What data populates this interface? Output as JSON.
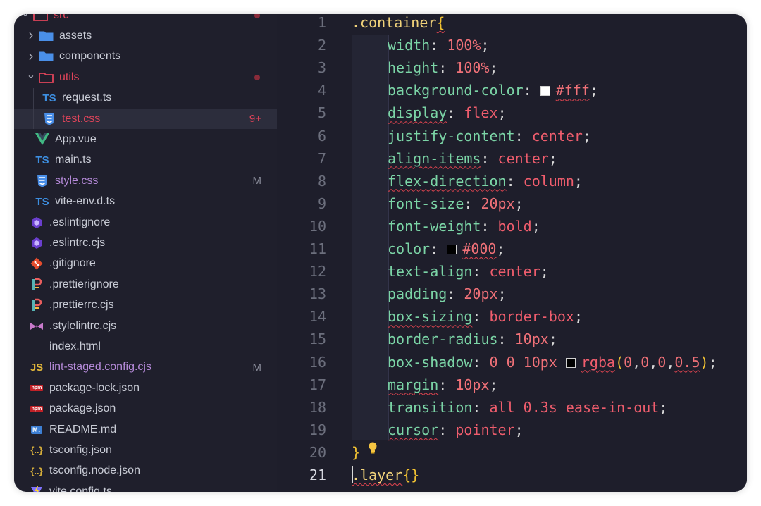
{
  "explorer": {
    "items": [
      {
        "label": "src",
        "kind": "folder-open",
        "color": "#e0445a",
        "indent": 0,
        "chevron": "down",
        "dot": true
      },
      {
        "label": "assets",
        "kind": "folder",
        "indent": 1,
        "chevron": "right"
      },
      {
        "label": "components",
        "kind": "folder",
        "indent": 1,
        "chevron": "right"
      },
      {
        "label": "utils",
        "kind": "folder-open",
        "color": "#e0445a",
        "indent": 1,
        "chevron": "down",
        "dot": true
      },
      {
        "label": "request.ts",
        "kind": "ts",
        "indent": 2
      },
      {
        "label": "test.css",
        "kind": "css",
        "color": "#e0445a",
        "indent": 2,
        "selected": true,
        "badge": "9+",
        "badge_color": "#e0445a"
      },
      {
        "label": "App.vue",
        "kind": "vue",
        "indent": 1
      },
      {
        "label": "main.ts",
        "kind": "ts",
        "indent": 1
      },
      {
        "label": "style.css",
        "kind": "css",
        "color": "#b58ad9",
        "indent": 1,
        "badge": "M"
      },
      {
        "label": "vite-env.d.ts",
        "kind": "ts",
        "indent": 1
      },
      {
        "label": ".eslintignore",
        "kind": "eslint",
        "indent": 0
      },
      {
        "label": ".eslintrc.cjs",
        "kind": "eslint",
        "indent": 0
      },
      {
        "label": ".gitignore",
        "kind": "git",
        "indent": 0
      },
      {
        "label": ".prettierignore",
        "kind": "prettier",
        "indent": 0
      },
      {
        "label": ".prettierrc.cjs",
        "kind": "prettier",
        "indent": 0
      },
      {
        "label": ".stylelintrc.cjs",
        "kind": "stylelint",
        "indent": 0
      },
      {
        "label": "index.html",
        "kind": "html",
        "indent": 0
      },
      {
        "label": "lint-staged.config.cjs",
        "kind": "js",
        "color": "#b58ad9",
        "indent": 0,
        "badge": "M"
      },
      {
        "label": "package-lock.json",
        "kind": "npm",
        "indent": 0
      },
      {
        "label": "package.json",
        "kind": "npm",
        "indent": 0
      },
      {
        "label": "README.md",
        "kind": "md",
        "indent": 0
      },
      {
        "label": "tsconfig.json",
        "kind": "json",
        "indent": 0
      },
      {
        "label": "tsconfig.node.json",
        "kind": "json",
        "indent": 0
      },
      {
        "label": "vite.config.ts",
        "kind": "vite",
        "indent": 0
      }
    ],
    "icon_text": {
      "ts": "TS",
      "js": "JS",
      "npm": "npm",
      "md": "M↓",
      "json": "{..}",
      "html": "</>"
    }
  },
  "editor": {
    "active_line": 21,
    "lines": [
      {
        "n": "1",
        "tokens": [
          {
            "t": ".container",
            "c": "sel"
          },
          {
            "t": "{",
            "c": "brace squig"
          }
        ]
      },
      {
        "n": "2",
        "tokens": [
          {
            "t": "width",
            "c": "prop"
          },
          {
            "t": ": ",
            "c": "punc"
          },
          {
            "t": "100%",
            "c": "num"
          },
          {
            "t": ";",
            "c": "punc"
          }
        ]
      },
      {
        "n": "3",
        "tokens": [
          {
            "t": "height",
            "c": "prop"
          },
          {
            "t": ": ",
            "c": "punc"
          },
          {
            "t": "100%",
            "c": "num"
          },
          {
            "t": ";",
            "c": "punc"
          }
        ]
      },
      {
        "n": "4",
        "tokens": [
          {
            "t": "background-color",
            "c": "prop"
          },
          {
            "t": ": ",
            "c": "punc"
          },
          {
            "swatch": "#ffffff"
          },
          {
            "t": "#fff",
            "c": "num squig"
          },
          {
            "t": ";",
            "c": "punc"
          }
        ]
      },
      {
        "n": "5",
        "tokens": [
          {
            "t": "display",
            "c": "prop squig"
          },
          {
            "t": ": ",
            "c": "punc"
          },
          {
            "t": "flex",
            "c": "val"
          },
          {
            "t": ";",
            "c": "punc"
          }
        ]
      },
      {
        "n": "6",
        "tokens": [
          {
            "t": "justify-content",
            "c": "prop"
          },
          {
            "t": ": ",
            "c": "punc"
          },
          {
            "t": "center",
            "c": "val"
          },
          {
            "t": ";",
            "c": "punc"
          }
        ]
      },
      {
        "n": "7",
        "tokens": [
          {
            "t": "align-items",
            "c": "prop squig"
          },
          {
            "t": ": ",
            "c": "punc"
          },
          {
            "t": "center",
            "c": "val"
          },
          {
            "t": ";",
            "c": "punc"
          }
        ]
      },
      {
        "n": "8",
        "tokens": [
          {
            "t": "flex-direction",
            "c": "prop squig"
          },
          {
            "t": ": ",
            "c": "punc"
          },
          {
            "t": "column",
            "c": "val"
          },
          {
            "t": ";",
            "c": "punc"
          }
        ]
      },
      {
        "n": "9",
        "tokens": [
          {
            "t": "font-size",
            "c": "prop"
          },
          {
            "t": ": ",
            "c": "punc"
          },
          {
            "t": "20px",
            "c": "num"
          },
          {
            "t": ";",
            "c": "punc"
          }
        ]
      },
      {
        "n": "10",
        "tokens": [
          {
            "t": "font-weight",
            "c": "prop"
          },
          {
            "t": ": ",
            "c": "punc"
          },
          {
            "t": "bold",
            "c": "val"
          },
          {
            "t": ";",
            "c": "punc"
          }
        ]
      },
      {
        "n": "11",
        "tokens": [
          {
            "t": "color",
            "c": "prop"
          },
          {
            "t": ": ",
            "c": "punc"
          },
          {
            "swatch": "#000000"
          },
          {
            "t": "#000",
            "c": "num squig"
          },
          {
            "t": ";",
            "c": "punc"
          }
        ]
      },
      {
        "n": "12",
        "tokens": [
          {
            "t": "text-align",
            "c": "prop"
          },
          {
            "t": ": ",
            "c": "punc"
          },
          {
            "t": "center",
            "c": "val"
          },
          {
            "t": ";",
            "c": "punc"
          }
        ]
      },
      {
        "n": "13",
        "tokens": [
          {
            "t": "padding",
            "c": "prop"
          },
          {
            "t": ": ",
            "c": "punc"
          },
          {
            "t": "20px",
            "c": "num"
          },
          {
            "t": ";",
            "c": "punc"
          }
        ]
      },
      {
        "n": "14",
        "tokens": [
          {
            "t": "box-sizing",
            "c": "prop squig"
          },
          {
            "t": ": ",
            "c": "punc"
          },
          {
            "t": "border-box",
            "c": "val"
          },
          {
            "t": ";",
            "c": "punc"
          }
        ]
      },
      {
        "n": "15",
        "tokens": [
          {
            "t": "border-radius",
            "c": "prop"
          },
          {
            "t": ": ",
            "c": "punc"
          },
          {
            "t": "10px",
            "c": "num"
          },
          {
            "t": ";",
            "c": "punc"
          }
        ]
      },
      {
        "n": "16",
        "tokens": [
          {
            "t": "box-shadow",
            "c": "prop"
          },
          {
            "t": ": ",
            "c": "punc"
          },
          {
            "t": "0 0 10px ",
            "c": "num"
          },
          {
            "swatch": "#000000"
          },
          {
            "t": "rgba",
            "c": "val squig"
          },
          {
            "t": "(",
            "c": "brace"
          },
          {
            "t": "0",
            "c": "num"
          },
          {
            "t": ",",
            "c": "punc"
          },
          {
            "t": "0",
            "c": "num"
          },
          {
            "t": ",",
            "c": "punc"
          },
          {
            "t": "0",
            "c": "num"
          },
          {
            "t": ",",
            "c": "punc"
          },
          {
            "t": "0.5",
            "c": "num squig"
          },
          {
            "t": ")",
            "c": "brace"
          },
          {
            "t": ";",
            "c": "punc"
          }
        ]
      },
      {
        "n": "17",
        "tokens": [
          {
            "t": "margin",
            "c": "prop squig"
          },
          {
            "t": ": ",
            "c": "punc"
          },
          {
            "t": "10px",
            "c": "num"
          },
          {
            "t": ";",
            "c": "punc"
          }
        ]
      },
      {
        "n": "18",
        "tokens": [
          {
            "t": "transition",
            "c": "prop"
          },
          {
            "t": ": ",
            "c": "punc"
          },
          {
            "t": "all 0.3s ease-in-out",
            "c": "val"
          },
          {
            "t": ";",
            "c": "punc"
          }
        ]
      },
      {
        "n": "19",
        "tokens": [
          {
            "t": "cursor",
            "c": "prop squig"
          },
          {
            "t": ": ",
            "c": "punc"
          },
          {
            "t": "pointer",
            "c": "val"
          },
          {
            "t": ";",
            "c": "punc"
          }
        ]
      },
      {
        "n": "20",
        "tokens": [
          {
            "t": "}",
            "c": "brace"
          }
        ]
      },
      {
        "n": "21",
        "tokens": [
          {
            "t": ".layer",
            "c": "sel squig"
          },
          {
            "t": "{}",
            "c": "brace"
          }
        ]
      }
    ]
  },
  "colors": {
    "selector": "#f0d27a",
    "property": "#7bd4a6",
    "value": "#ef5d6d",
    "error_squiggle": "#e0444f",
    "background": "#1e1e2b"
  }
}
